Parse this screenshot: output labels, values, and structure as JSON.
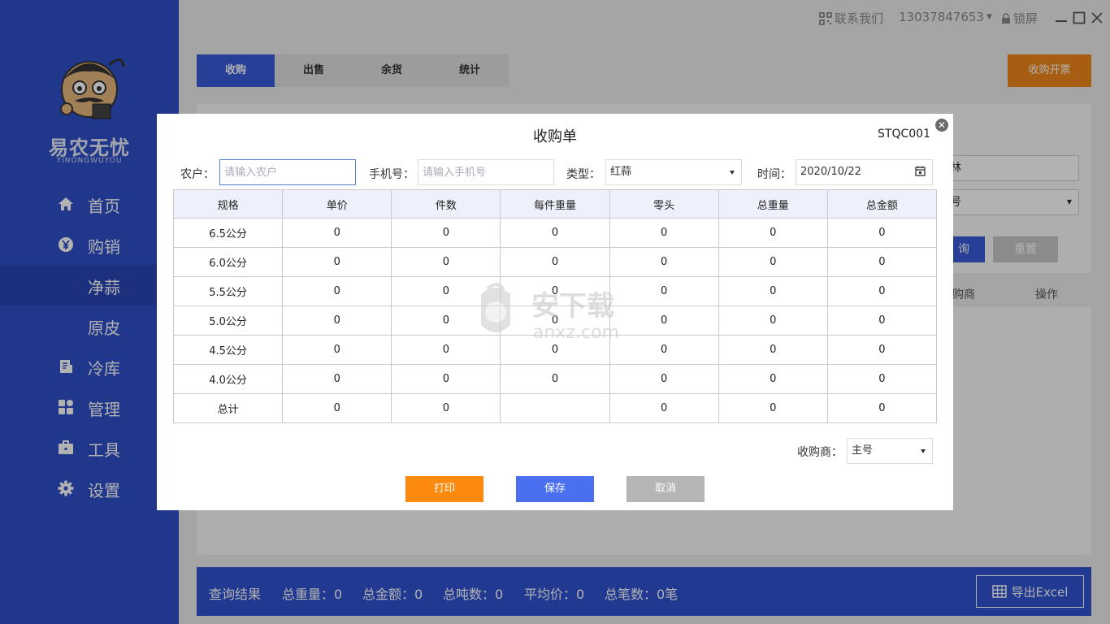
{
  "app": {
    "brand_name": "易农无忧",
    "brand_sub": "YINONGWUYOU"
  },
  "sidebar": {
    "items": [
      {
        "label": "首页",
        "icon": "home-icon"
      },
      {
        "label": "购销",
        "icon": "yen-icon"
      },
      {
        "label": "净蒜",
        "icon": ""
      },
      {
        "label": "原皮",
        "icon": ""
      },
      {
        "label": "冷库",
        "icon": "document-icon"
      },
      {
        "label": "管理",
        "icon": "grid-icon"
      },
      {
        "label": "工具",
        "icon": "briefcase-icon"
      },
      {
        "label": "设置",
        "icon": "gear-icon"
      }
    ]
  },
  "topbar": {
    "contact": "联系我们",
    "phone": "13037847653",
    "lock": "锁屏"
  },
  "tabs": [
    "收购",
    "出售",
    "余货",
    "统计"
  ],
  "invoice_button": "收购开票",
  "background": {
    "partial_field1": "林",
    "partial_field2": "号",
    "query_button": "询",
    "reset_button": "重置",
    "col_partial": "购商",
    "col_action": "操作"
  },
  "footer": {
    "query_result": "查询结果",
    "total_weight": "总重量：0",
    "total_amount": "总金额：0",
    "total_tons": "总吨数：0",
    "avg_price": "平均价：0",
    "total_count": "总笔数：0笔",
    "export_button": "导出Excel"
  },
  "modal": {
    "title": "收购单",
    "code": "STQC001",
    "farmer_label": "农户：",
    "farmer_placeholder": "请输入农户",
    "phone_label": "手机号：",
    "phone_placeholder": "请输入手机号",
    "type_label": "类型：",
    "type_value": "红蒜",
    "time_label": "时间：",
    "time_value": "2020/10/22",
    "buyer_label": "收购商：",
    "buyer_value": "主号",
    "print_button": "打印",
    "save_button": "保存",
    "cancel_button": "取消",
    "table": {
      "headers": [
        "规格",
        "单价",
        "件数",
        "每件重量",
        "零头",
        "总重量",
        "总金额"
      ],
      "rows": [
        [
          "6.5公分",
          "0",
          "0",
          "0",
          "0",
          "0",
          "0"
        ],
        [
          "6.0公分",
          "0",
          "0",
          "0",
          "0",
          "0",
          "0"
        ],
        [
          "5.5公分",
          "0",
          "0",
          "0",
          "0",
          "0",
          "0"
        ],
        [
          "5.0公分",
          "0",
          "0",
          "0",
          "0",
          "0",
          "0"
        ],
        [
          "4.5公分",
          "0",
          "0",
          "0",
          "0",
          "0",
          "0"
        ],
        [
          "4.0公分",
          "0",
          "0",
          "0",
          "0",
          "0",
          "0"
        ],
        [
          "总计",
          "0",
          "0",
          "",
          "0",
          "0",
          "0"
        ]
      ]
    }
  },
  "colors": {
    "sidebar": "#2f4fc9",
    "primary": "#3a5bd9",
    "orange": "#f0861a",
    "save_blue": "#4a6ff0",
    "cancel_gray": "#b5b5b5"
  }
}
